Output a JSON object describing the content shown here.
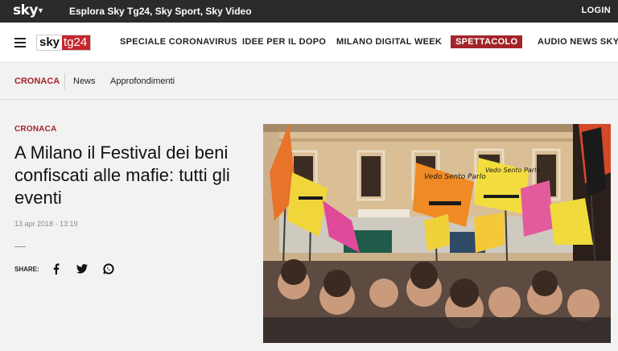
{
  "topbar": {
    "logo": "sky",
    "explore": "Esplora Sky Tg24, Sky Sport, Sky Video",
    "login": "LOGIN"
  },
  "navbar": {
    "brand_sky": "sky",
    "brand_tg": "tg24",
    "items": [
      "SPECIALE CORONAVIRUS",
      "IDEE PER IL DOPO",
      "MILANO DIGITAL WEEK",
      "SPETTACOLO",
      "AUDIO NEWS SKY TG"
    ],
    "active_item": "SPETTACOLO"
  },
  "subnav": {
    "category": "CRONACA",
    "links": [
      "News",
      "Approfondimenti"
    ]
  },
  "article": {
    "kicker": "CRONACA",
    "headline": "A Milano il Festival dei beni confiscati alle mafie: tutti gli eventi",
    "date": "13 apr 2018 - 13:19",
    "share_label": "SHARE:",
    "share_icons": [
      "facebook-icon",
      "twitter-icon",
      "whatsapp-icon"
    ]
  },
  "photo": {
    "banner_texts": [
      "Vedo Sento Parlo",
      "LEA VIVE",
      "LEA GAROFALO"
    ]
  },
  "colors": {
    "accent": "#a3242a",
    "brand_red": "#c8262d",
    "topbar": "#2b2b2b"
  }
}
